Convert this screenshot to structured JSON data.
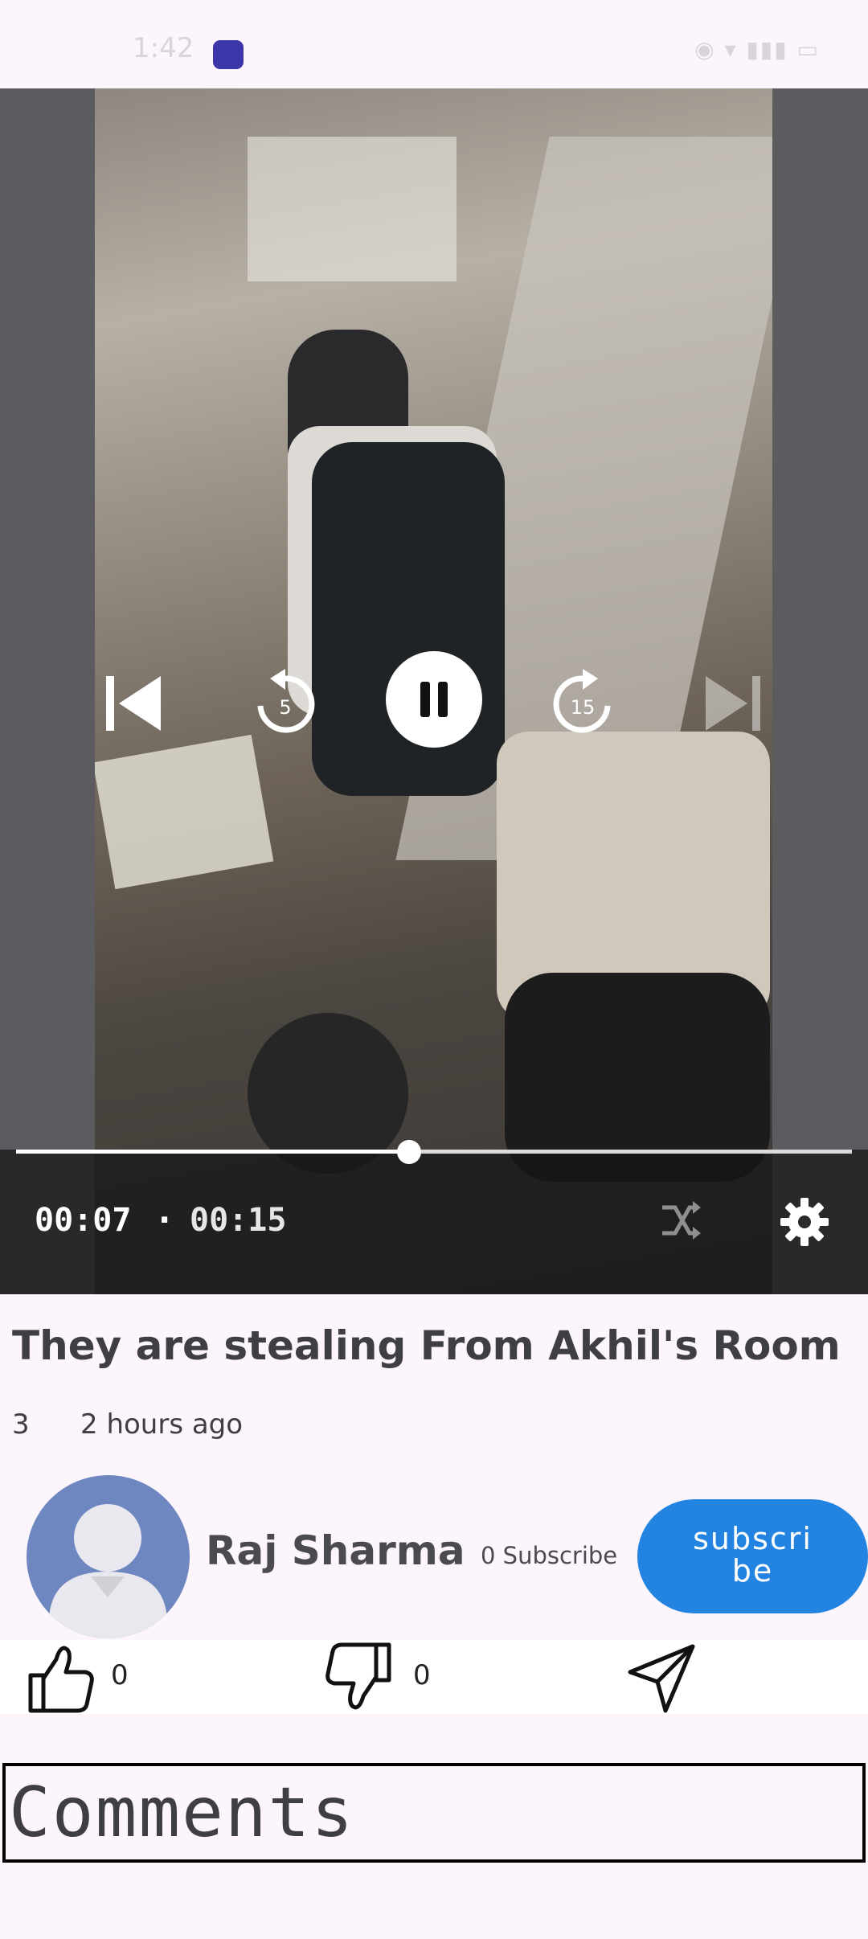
{
  "status_bar": {
    "time": "1:42"
  },
  "player": {
    "current_time": "00:07",
    "separator": "·",
    "duration": "00:15",
    "progress": 0.47,
    "rewind_seconds": "5",
    "forward_seconds": "15"
  },
  "video": {
    "title": "They are stealing From Akhil's Room",
    "views": "3",
    "posted": "2 hours ago"
  },
  "channel": {
    "name": "Raj Sharma",
    "subscribers": "0 Subscribe",
    "subscribe_label": "subscri be"
  },
  "actions": {
    "likes": "0",
    "dislikes": "0"
  },
  "comments": {
    "heading": "Comments"
  }
}
